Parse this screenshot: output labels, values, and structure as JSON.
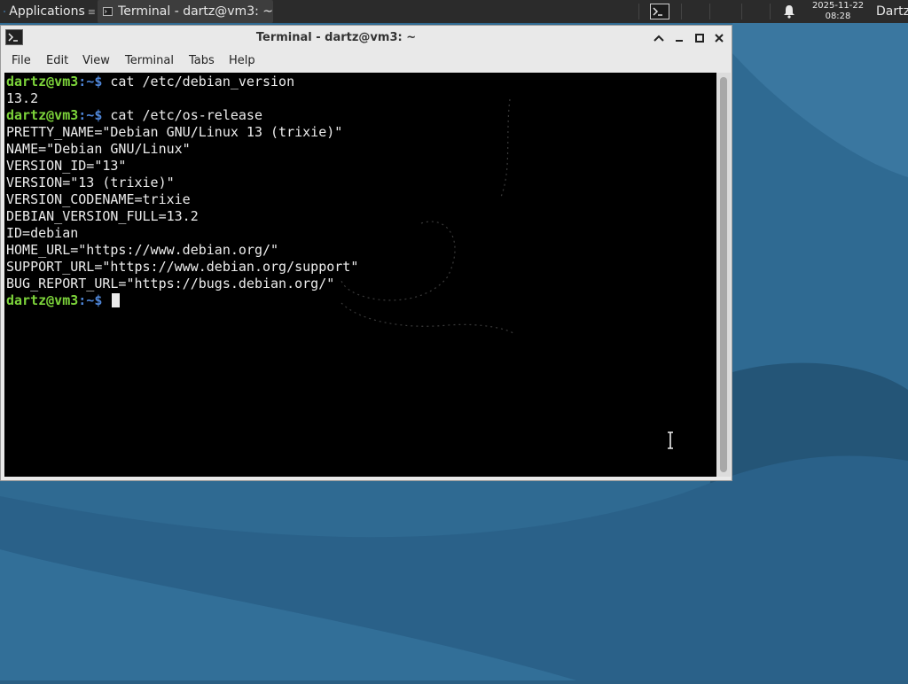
{
  "panel": {
    "apps_label": "Applications",
    "task_label": "Terminal - dartz@vm3: ~",
    "clock_date": "2025-11-22",
    "clock_time": "08:28",
    "user_label": "Dartz"
  },
  "window": {
    "title": "Terminal - dartz@vm3: ~"
  },
  "menubar": {
    "items": [
      "File",
      "Edit",
      "View",
      "Terminal",
      "Tabs",
      "Help"
    ]
  },
  "terminal": {
    "prompt_user": "dartz@vm3",
    "prompt_path": ":~",
    "prompt_symbol": "$",
    "commands": [
      "cat /etc/debian_version",
      "cat /etc/os-release"
    ],
    "output_debian_version": [
      "13.2"
    ],
    "output_os_release": [
      "PRETTY_NAME=\"Debian GNU/Linux 13 (trixie)\"",
      "NAME=\"Debian GNU/Linux\"",
      "VERSION_ID=\"13\"",
      "VERSION=\"13 (trixie)\"",
      "VERSION_CODENAME=trixie",
      "DEBIAN_VERSION_FULL=13.2",
      "ID=debian",
      "HOME_URL=\"https://www.debian.org/\"",
      "SUPPORT_URL=\"https://www.debian.org/support\"",
      "BUG_REPORT_URL=\"https://bugs.debian.org/\""
    ]
  },
  "colors": {
    "prompt_user": "#7cd33a",
    "prompt_path": "#4f86d8",
    "terminal_bg": "#000000",
    "panel_bg": "#2b2b2b",
    "wallpaper": "#2b5f84"
  }
}
